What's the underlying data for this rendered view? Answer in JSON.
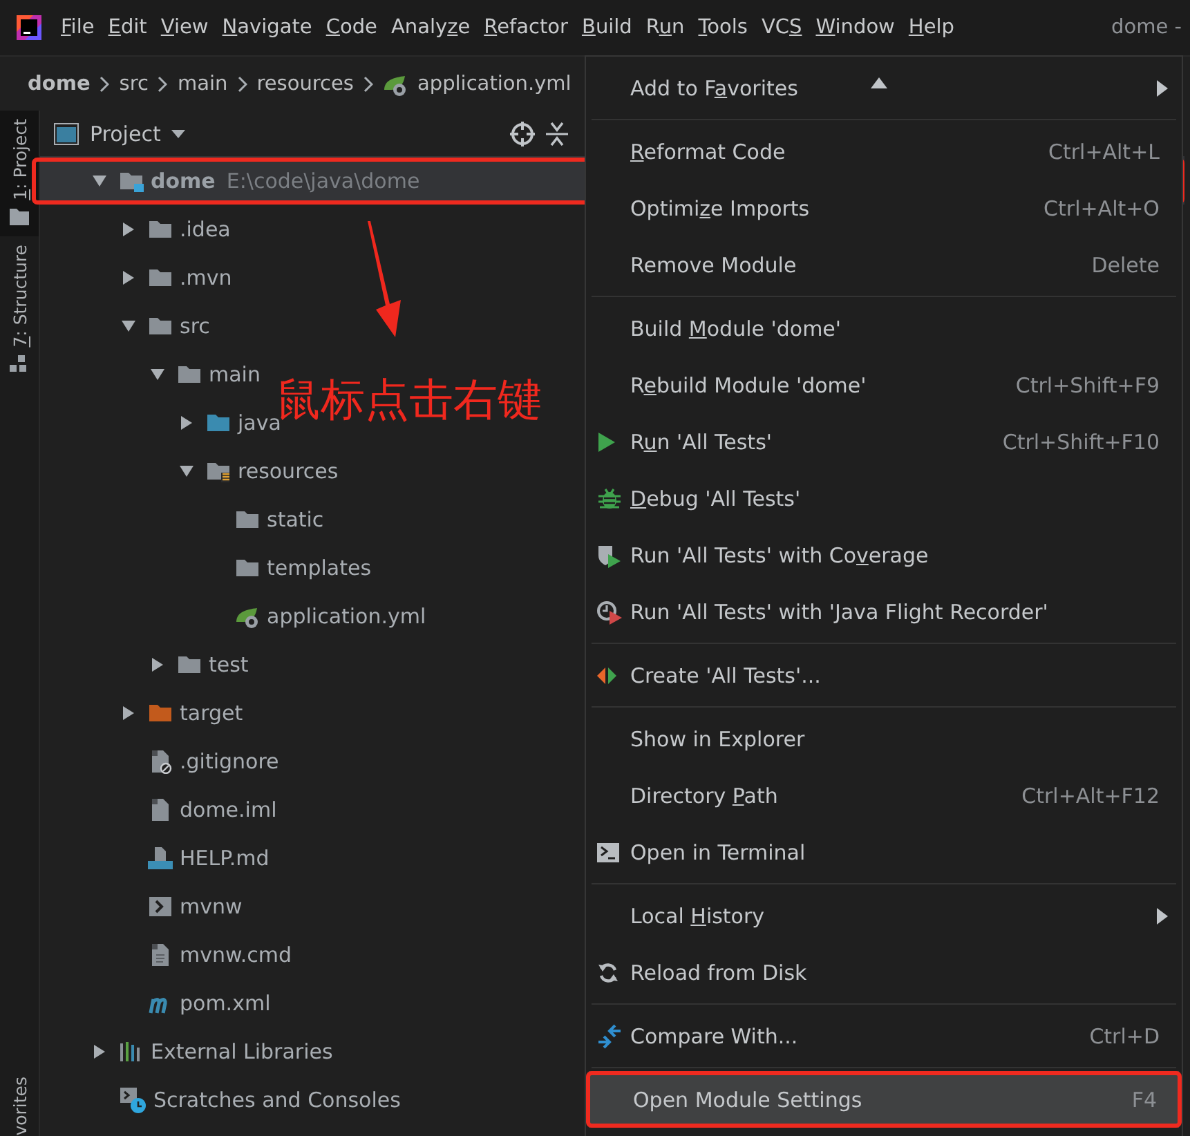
{
  "menubar": [
    {
      "label": {
        "key": "F",
        "after": "ile"
      }
    },
    {
      "label": {
        "key": "E",
        "after": "dit"
      }
    },
    {
      "label": {
        "key": "V",
        "after": "iew"
      }
    },
    {
      "label": {
        "key": "N",
        "after": "avigate"
      }
    },
    {
      "label": {
        "key": "C",
        "after": "ode"
      }
    },
    {
      "label": {
        "before": "Analy",
        "key": "z",
        "after": "e"
      }
    },
    {
      "label": {
        "key": "R",
        "after": "efactor"
      }
    },
    {
      "label": {
        "key": "B",
        "after": "uild"
      }
    },
    {
      "label": {
        "before": "R",
        "key": "u",
        "after": "n"
      }
    },
    {
      "label": {
        "key": "T",
        "after": "ools"
      }
    },
    {
      "label": {
        "before": "VC",
        "key": "S"
      }
    },
    {
      "label": {
        "key": "W",
        "after": "indow"
      }
    },
    {
      "label": {
        "key": "H",
        "after": "elp"
      }
    }
  ],
  "window": {
    "title": "dome -"
  },
  "breadcrumb": [
    {
      "label": "dome",
      "kind": "module"
    },
    {
      "label": "src",
      "kind": "plain"
    },
    {
      "label": "main",
      "kind": "plain"
    },
    {
      "label": "resources",
      "kind": "plain"
    },
    {
      "label": "application.yml",
      "kind": "yml"
    }
  ],
  "tool_strip": [
    {
      "label": {
        "key": "1",
        "after": ": Project"
      },
      "kind": "project",
      "selected": true
    },
    {
      "label": {
        "key": "7",
        "after": ": Structure"
      },
      "kind": "structure",
      "selected": false
    }
  ],
  "tool_strip_bottom": {
    "label": "vorites"
  },
  "panel": {
    "title": "Project"
  },
  "tree": [
    {
      "name": "dome",
      "path": "E:\\code\\java\\dome",
      "kind": "module",
      "expanded": true,
      "selected": true,
      "children": [
        {
          "name": ".idea",
          "kind": "folder",
          "expanded": false,
          "selected": false
        },
        {
          "name": ".mvn",
          "kind": "folder",
          "expanded": false,
          "selected": false
        },
        {
          "name": "src",
          "kind": "folder",
          "expanded": true,
          "selected": false,
          "children": [
            {
              "name": "main",
              "kind": "folder",
              "expanded": true,
              "selected": false,
              "children": [
                {
                  "name": "java",
                  "kind": "source",
                  "expanded": false,
                  "selected": false
                },
                {
                  "name": "resources",
                  "kind": "resources",
                  "expanded": true,
                  "selected": false,
                  "children": [
                    {
                      "name": "static",
                      "kind": "folder",
                      "selected": false
                    },
                    {
                      "name": "templates",
                      "kind": "folder",
                      "selected": false
                    },
                    {
                      "name": "application.yml",
                      "kind": "yml",
                      "selected": false
                    }
                  ]
                }
              ]
            },
            {
              "name": "test",
              "kind": "folder",
              "expanded": false,
              "selected": false
            }
          ]
        },
        {
          "name": "target",
          "kind": "excluded",
          "expanded": false,
          "selected": false
        },
        {
          "name": ".gitignore",
          "kind": "gitignore",
          "selected": false
        },
        {
          "name": "dome.iml",
          "kind": "iml",
          "selected": false
        },
        {
          "name": "HELP.md",
          "kind": "markdown",
          "selected": false
        },
        {
          "name": "mvnw",
          "kind": "shell",
          "selected": false
        },
        {
          "name": "mvnw.cmd",
          "kind": "cmd",
          "selected": false
        },
        {
          "name": "pom.xml",
          "kind": "maven",
          "selected": false
        }
      ]
    },
    {
      "name": "External Libraries",
      "kind": "libraries",
      "expanded": false,
      "selected": false
    },
    {
      "name": "Scratches and Consoles",
      "kind": "scratches",
      "selected": false
    }
  ],
  "annotation": {
    "text": "鼠标点击右键"
  },
  "context_menu": {
    "groups": [
      {
        "items": [
          {
            "label": {
              "before": "Add to F",
              "key": "a",
              "after": "vorites"
            },
            "kind": "plain",
            "submenu": true,
            "selected": false
          }
        ]
      },
      {
        "items": [
          {
            "label": {
              "key": "R",
              "after": "eformat Code"
            },
            "shortcut": "Ctrl+Alt+L",
            "kind": "plain",
            "selected": false
          },
          {
            "label": {
              "before": "Optimi",
              "key": "z",
              "after": "e Imports"
            },
            "shortcut": "Ctrl+Alt+O",
            "kind": "plain",
            "selected": false
          },
          {
            "label": {
              "text": "Remove Module"
            },
            "shortcut": "Delete",
            "kind": "plain",
            "selected": false
          }
        ]
      },
      {
        "items": [
          {
            "label": {
              "before": "Build ",
              "key": "M",
              "after": "odule 'dome'"
            },
            "kind": "plain",
            "selected": false
          },
          {
            "label": {
              "before": "R",
              "key": "e",
              "after": "build Module 'dome'"
            },
            "shortcut": "Ctrl+Shift+F9",
            "kind": "plain",
            "selected": false
          },
          {
            "label": {
              "before": "R",
              "key": "u",
              "after": "n 'All Tests'"
            },
            "shortcut": "Ctrl+Shift+F10",
            "kind": "run",
            "selected": false
          },
          {
            "label": {
              "key": "D",
              "after": "ebug 'All Tests'"
            },
            "kind": "debug",
            "selected": false
          },
          {
            "label": {
              "before": "Run 'All Tests' with Co",
              "key": "v",
              "after": "erage"
            },
            "kind": "coverage",
            "selected": false
          },
          {
            "label": {
              "text": "Run 'All Tests' with 'Java Flight Recorder'"
            },
            "kind": "profiler",
            "selected": false
          }
        ]
      },
      {
        "items": [
          {
            "label": {
              "text": "Create 'All Tests'..."
            },
            "kind": "create",
            "selected": false
          }
        ]
      },
      {
        "items": [
          {
            "label": {
              "text": "Show in Explorer"
            },
            "kind": "plain",
            "selected": false
          },
          {
            "label": {
              "before": "Directory ",
              "key": "P",
              "after": "ath"
            },
            "shortcut": "Ctrl+Alt+F12",
            "kind": "plain",
            "selected": false
          },
          {
            "label": {
              "text": "Open in Terminal"
            },
            "kind": "terminal",
            "selected": false
          }
        ]
      },
      {
        "items": [
          {
            "label": {
              "before": "Local ",
              "key": "H",
              "after": "istory"
            },
            "kind": "plain",
            "submenu": true,
            "selected": false
          },
          {
            "label": {
              "text": "Reload from Disk"
            },
            "kind": "reload",
            "selected": false
          }
        ]
      },
      {
        "items": [
          {
            "label": {
              "text": "Compare With..."
            },
            "shortcut": "Ctrl+D",
            "kind": "compare",
            "selected": false
          }
        ]
      },
      {
        "items": [
          {
            "label": {
              "text": "Open Module Settings"
            },
            "shortcut": "F4",
            "kind": "plain",
            "selected": true
          }
        ]
      }
    ]
  }
}
